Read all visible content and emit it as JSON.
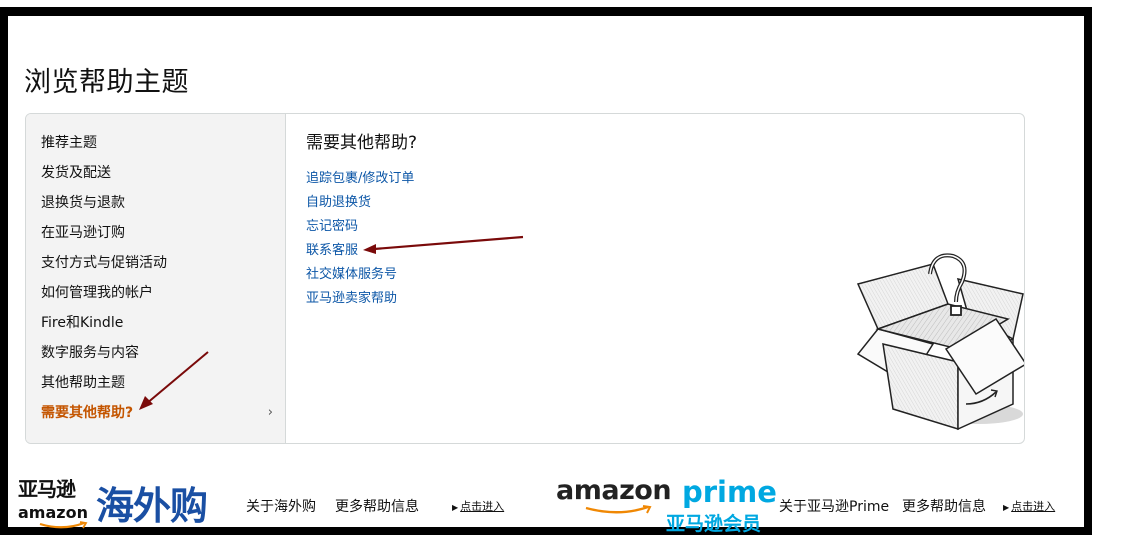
{
  "page": {
    "title": "浏览帮助主题"
  },
  "sidebar": {
    "items": [
      {
        "label": "推荐主题"
      },
      {
        "label": "发货及配送"
      },
      {
        "label": "退换货与退款"
      },
      {
        "label": "在亚马逊订购"
      },
      {
        "label": "支付方式与促销活动"
      },
      {
        "label": "如何管理我的帐户"
      },
      {
        "label": "Fire和Kindle"
      },
      {
        "label": "数字服务与内容"
      },
      {
        "label": "其他帮助主题"
      },
      {
        "label": "需要其他帮助?",
        "chevron": "›"
      }
    ]
  },
  "panel": {
    "heading": "需要其他帮助?",
    "links": [
      {
        "label": "追踪包裹/修改订单"
      },
      {
        "label": "自助退换货"
      },
      {
        "label": "忘记密码"
      },
      {
        "label": "联系客服"
      },
      {
        "label": "社交媒体服务号"
      },
      {
        "label": "亚马逊卖家帮助"
      }
    ]
  },
  "footer": {
    "haiwaigou_logo": {
      "cn_top": "亚马逊",
      "en": "amazon",
      "cn_big": "海外购"
    },
    "haiwaigou_about": "关于海外购",
    "haiwaigou_more": "更多帮助信息",
    "haiwaigou_enter": "点击进入",
    "prime_logo": {
      "amazon": "amazon",
      "prime": "prime",
      "cn": "亚马逊会员"
    },
    "prime_about": "关于亚马逊Prime",
    "prime_more": "更多帮助信息",
    "prime_enter": "点击进入"
  },
  "colors": {
    "link": "#0d57a7",
    "active": "#c45500",
    "annotation_arrow": "#7a0a0a",
    "prime_blue": "#00a8e1",
    "haiwaigou_blue": "#1a4fa3"
  },
  "icons": [
    "chevron-right-icon",
    "question-box-illustration",
    "triangle-right-icon"
  ]
}
